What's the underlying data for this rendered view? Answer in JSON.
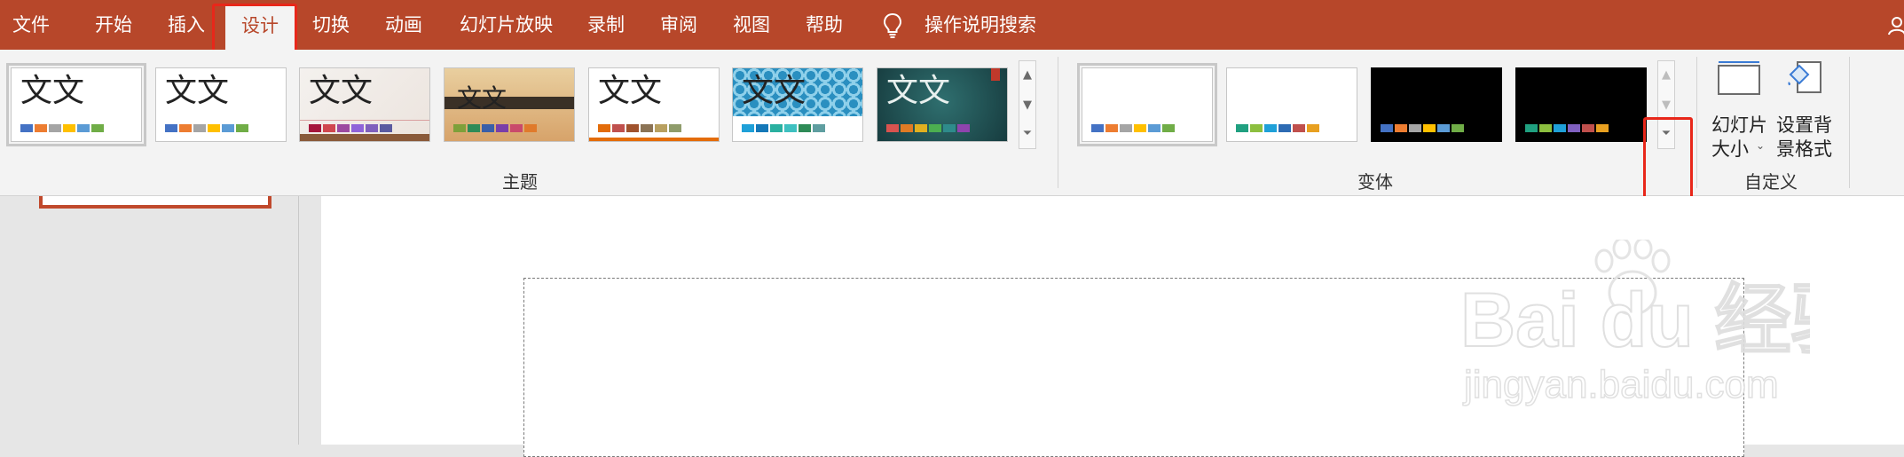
{
  "tabs": [
    {
      "id": "file",
      "label": "文件"
    },
    {
      "id": "home",
      "label": "开始"
    },
    {
      "id": "insert",
      "label": "插入"
    },
    {
      "id": "design",
      "label": "设计",
      "active": true
    },
    {
      "id": "transitions",
      "label": "切换"
    },
    {
      "id": "animations",
      "label": "动画"
    },
    {
      "id": "slideshow",
      "label": "幻灯片放映"
    },
    {
      "id": "record",
      "label": "录制"
    },
    {
      "id": "review",
      "label": "审阅"
    },
    {
      "id": "view",
      "label": "视图"
    },
    {
      "id": "help",
      "label": "帮助"
    }
  ],
  "tell_me": {
    "label": "操作说明搜索",
    "icon": "lightbulb-icon"
  },
  "themes": {
    "group_label": "主题",
    "items": [
      {
        "text": "文文",
        "style": "office",
        "swatches": [
          "#4472c4",
          "#ed7d31",
          "#a5a5a5",
          "#ffc000",
          "#5b9bd5",
          "#70ad47"
        ]
      },
      {
        "text": "文文",
        "style": "office2",
        "swatches": [
          "#4472c4",
          "#ed7d31",
          "#a5a5a5",
          "#ffc000",
          "#5b9bd5",
          "#70ad47"
        ]
      },
      {
        "text": "文文",
        "style": "paper",
        "swatches": [
          "#a5163c",
          "#d0474f",
          "#9c4aa0",
          "#8f63d9",
          "#7f5fbd",
          "#5a5aa0"
        ]
      },
      {
        "text": "文文",
        "style": "wood",
        "swatches": [
          "#7ea03a",
          "#2e8b57",
          "#3a5ea8",
          "#7a3ea8",
          "#c94a6b",
          "#e07a2b"
        ]
      },
      {
        "text": "文文",
        "style": "retrospect",
        "swatches": [
          "#e36c0a",
          "#c0504d",
          "#a0522d",
          "#8b7355",
          "#b8a060",
          "#8f9c6b"
        ]
      },
      {
        "text": "文文",
        "style": "pattern",
        "swatches": [
          "#1fa0d8",
          "#1478b8",
          "#2ab0a0",
          "#3ec0c0",
          "#2e8b57",
          "#5f9ea0"
        ]
      },
      {
        "text": "文文",
        "style": "chalk",
        "swatches": [
          "#d9534f",
          "#e07b24",
          "#e0b020",
          "#4caf50",
          "#2e8b8b",
          "#8e44ad"
        ]
      }
    ]
  },
  "variants": {
    "group_label": "变体",
    "items": [
      {
        "bg": "#ffffff",
        "swatches": [
          "#4472c4",
          "#ed7d31",
          "#a5a5a5",
          "#ffc000",
          "#5b9bd5",
          "#70ad47"
        ]
      },
      {
        "bg": "#ffffff",
        "swatches": [
          "#20a080",
          "#8cbf3f",
          "#1fa0d8",
          "#2d6bb3",
          "#c0504d",
          "#e8a020"
        ]
      },
      {
        "bg": "#000000",
        "swatches": [
          "#4472c4",
          "#ed7d31",
          "#a5a5a5",
          "#ffc000",
          "#5b9bd5",
          "#70ad47"
        ]
      },
      {
        "bg": "#000000",
        "swatches": [
          "#20a080",
          "#8cbf3f",
          "#1fa0d8",
          "#8060c0",
          "#c0504d",
          "#e8a020"
        ]
      }
    ]
  },
  "customize": {
    "group_label": "自定义",
    "slide_size_line1": "幻灯片",
    "slide_size_line2": "大小",
    "bg_format_line1": "设置背",
    "bg_format_line2": "景格式"
  },
  "watermark": {
    "brand": "Bai du 经验",
    "url": "jingyan.baidu.com"
  },
  "colors": {
    "accent": "#b7472a",
    "annotation": "#e8271a"
  }
}
